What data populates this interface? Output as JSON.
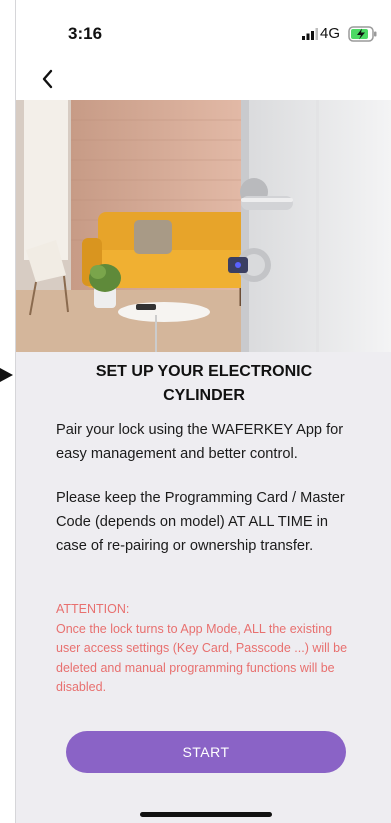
{
  "status_bar": {
    "time": "3:16",
    "network": "4G"
  },
  "icons": {
    "back": "chevron-left-icon",
    "signal": "signal-icon",
    "battery": "battery-charging-icon"
  },
  "setup": {
    "title": "SET UP YOUR ELECTRONIC CYLINDER",
    "paragraph1": "Pair your lock using the WAFERKEY App for easy management and better control.",
    "paragraph2": "Please keep the Programming Card / Master Code (depends on model) AT ALL TIME in case of re-pairing or ownership transfer.",
    "attention_heading": "ATTENTION:",
    "attention_body": "Once the lock turns to App Mode, ALL the existing user access settings (Key Card, Passcode ...) will be deleted and manual programming functions will be disabled.",
    "start_label": "START"
  },
  "colors": {
    "accent": "#8a63c6",
    "warning": "#e8706f",
    "background": "#eeedf1",
    "battery": "#4cd964"
  }
}
